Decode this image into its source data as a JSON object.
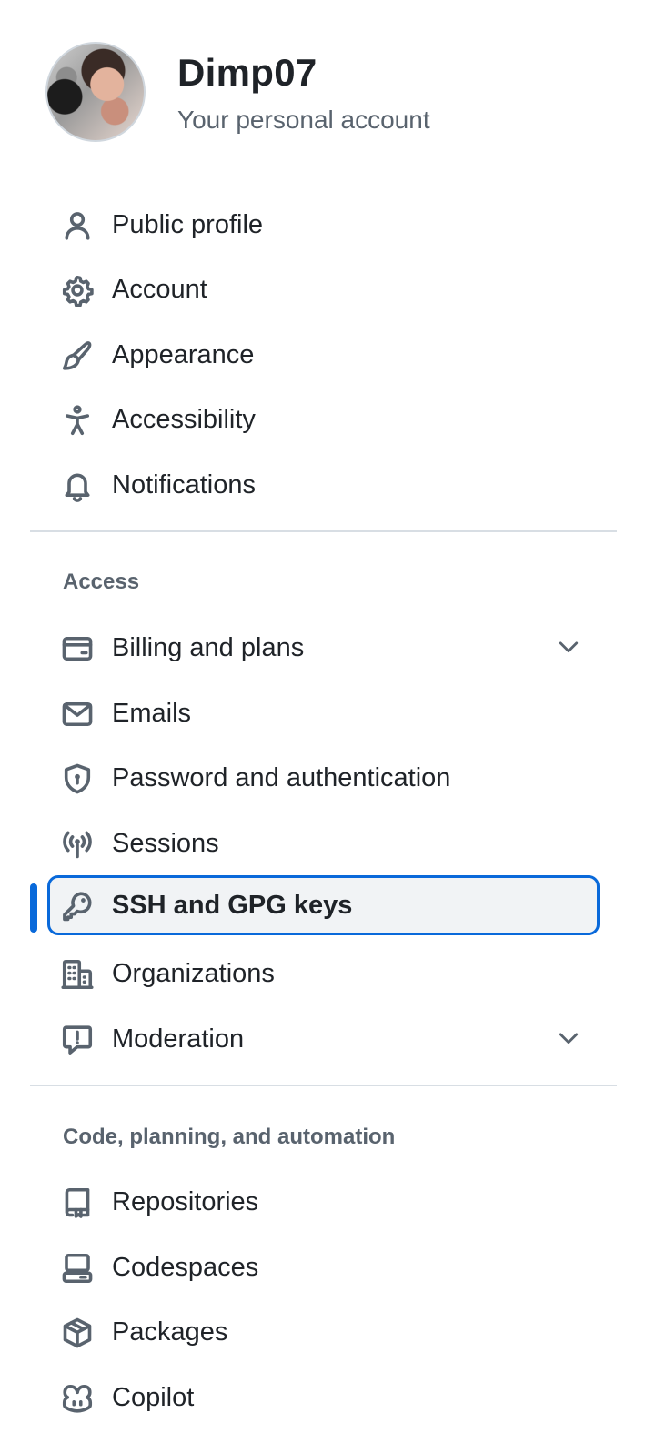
{
  "profile": {
    "username": "Dimp07",
    "subtitle": "Your personal account"
  },
  "nav_main": [
    {
      "label": "Public profile",
      "icon": "person-icon"
    },
    {
      "label": "Account",
      "icon": "gear-icon"
    },
    {
      "label": "Appearance",
      "icon": "paintbrush-icon"
    },
    {
      "label": "Accessibility",
      "icon": "accessibility-icon"
    },
    {
      "label": "Notifications",
      "icon": "bell-icon"
    }
  ],
  "sections": {
    "access": "Access",
    "code": "Code, planning, and automation"
  },
  "nav_access": [
    {
      "label": "Billing and plans",
      "icon": "credit-card-icon",
      "expandable": true
    },
    {
      "label": "Emails",
      "icon": "mail-icon"
    },
    {
      "label": "Password and authentication",
      "icon": "shield-lock-icon"
    },
    {
      "label": "Sessions",
      "icon": "broadcast-icon"
    },
    {
      "label": "SSH and GPG keys",
      "icon": "key-icon",
      "active": true
    },
    {
      "label": "Organizations",
      "icon": "organization-icon"
    },
    {
      "label": "Moderation",
      "icon": "report-icon",
      "expandable": true
    }
  ],
  "nav_code": [
    {
      "label": "Repositories",
      "icon": "repo-icon"
    },
    {
      "label": "Codespaces",
      "icon": "codespaces-icon"
    },
    {
      "label": "Packages",
      "icon": "package-icon"
    },
    {
      "label": "Copilot",
      "icon": "copilot-icon"
    }
  ],
  "colors": {
    "accent": "#0969da",
    "text": "#1f2328",
    "muted": "#59636e",
    "active_bg": "#f1f3f5"
  }
}
